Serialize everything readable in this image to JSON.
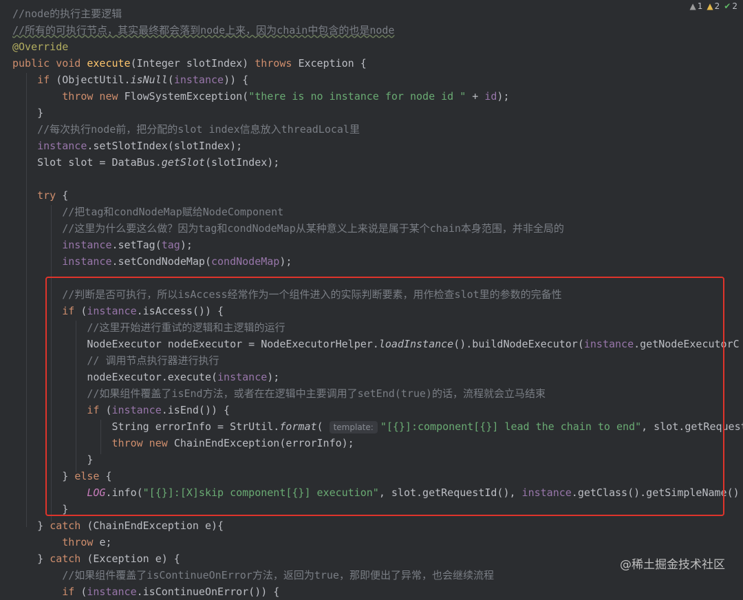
{
  "inspections": {
    "weak_warnings": "1",
    "warnings": "2",
    "typos": "2"
  },
  "code": {
    "l01": "//node的执行主要逻辑",
    "l02": "//所有的可执行节点，其实最终都会落到node上来，因为chain中包含的也是node",
    "l03": "@Override",
    "l04_a": "public void ",
    "l04_b": "execute",
    "l04_c": "(Integer slotIndex) ",
    "l04_d": "throws ",
    "l04_e": "Exception {",
    "l05_a": "if ",
    "l05_b": "(ObjectUtil.",
    "l05_c": "isNull",
    "l05_d": "(",
    "l05_e": "instance",
    "l05_f": ")) {",
    "l06_a": "throw new ",
    "l06_b": "FlowSystemException(",
    "l06_c": "\"there is no instance for node id \"",
    "l06_d": " + ",
    "l06_e": "id",
    "l06_f": ");",
    "l07": "}",
    "l08": "//每次执行node前，把分配的slot index信息放入threadLocal里",
    "l09_a": "instance",
    "l09_b": ".setSlotIndex(slotIndex);",
    "l10_a": "Slot slot = DataBus.",
    "l10_b": "getSlot",
    "l10_c": "(slotIndex);",
    "l12_a": "try ",
    "l12_b": "{",
    "l13": "//把tag和condNodeMap赋给NodeComponent",
    "l14": "//这里为什么要这么做？因为tag和condNodeMap从某种意义上来说是属于某个chain本身范围，并非全局的",
    "l15_a": "instance",
    "l15_b": ".setTag(",
    "l15_c": "tag",
    "l15_d": ");",
    "l16_a": "instance",
    "l16_b": ".setCondNodeMap(",
    "l16_c": "condNodeMap",
    "l16_d": ");",
    "l18": "//判断是否可执行，所以isAccess经常作为一个组件进入的实际判断要素，用作检查slot里的参数的完备性",
    "l19_a": "if ",
    "l19_b": "(",
    "l19_c": "instance",
    "l19_d": ".isAccess()) {",
    "l20": "//这里开始进行重试的逻辑和主逻辑的运行",
    "l21_a": "NodeExecutor nodeExecutor = NodeExecutorHelper.",
    "l21_b": "loadInstance",
    "l21_c": "().buildNodeExecutor(",
    "l21_d": "instance",
    "l21_e": ".getNodeExecutorC",
    "l22": "// 调用节点执行器进行执行",
    "l23_a": "nodeExecutor.execute(",
    "l23_b": "instance",
    "l23_c": ");",
    "l24": "//如果组件覆盖了isEnd方法，或者在在逻辑中主要调用了setEnd(true)的话，流程就会立马结束",
    "l25_a": "if ",
    "l25_b": "(",
    "l25_c": "instance",
    "l25_d": ".isEnd()) {",
    "l26_a": "String errorInfo = StrUtil.",
    "l26_b": "format",
    "l26_c": "( ",
    "l26_hint": "template:",
    "l26_d": "\"[{}]:component[{}] lead the chain to end\"",
    "l26_e": ", slot.getRequest",
    "l27_a": "throw new ",
    "l27_b": "ChainEndException(errorInfo);",
    "l28": "}",
    "l29_a": "} ",
    "l29_b": "else ",
    "l29_c": "{",
    "l30_a": "LOG",
    "l30_b": ".info(",
    "l30_c": "\"[{}]:[X]skip component[{}] execution\"",
    "l30_d": ", slot.getRequestId(), ",
    "l30_e": "instance",
    "l30_f": ".getClass().getSimpleName()",
    "l31": "}",
    "l32_a": "} ",
    "l32_b": "catch ",
    "l32_c": "(ChainEndException e){",
    "l33_a": "throw ",
    "l33_b": "e;",
    "l34_a": "} ",
    "l34_b": "catch ",
    "l34_c": "(Exception e) {",
    "l35": "//如果组件覆盖了isContinueOnError方法，返回为true，那即便出了异常，也会继续流程",
    "l36_a": "if ",
    "l36_b": "(",
    "l36_c": "instance",
    "l36_d": ".isContinueOnError()) {"
  },
  "watermark": "@稀土掘金技术社区"
}
